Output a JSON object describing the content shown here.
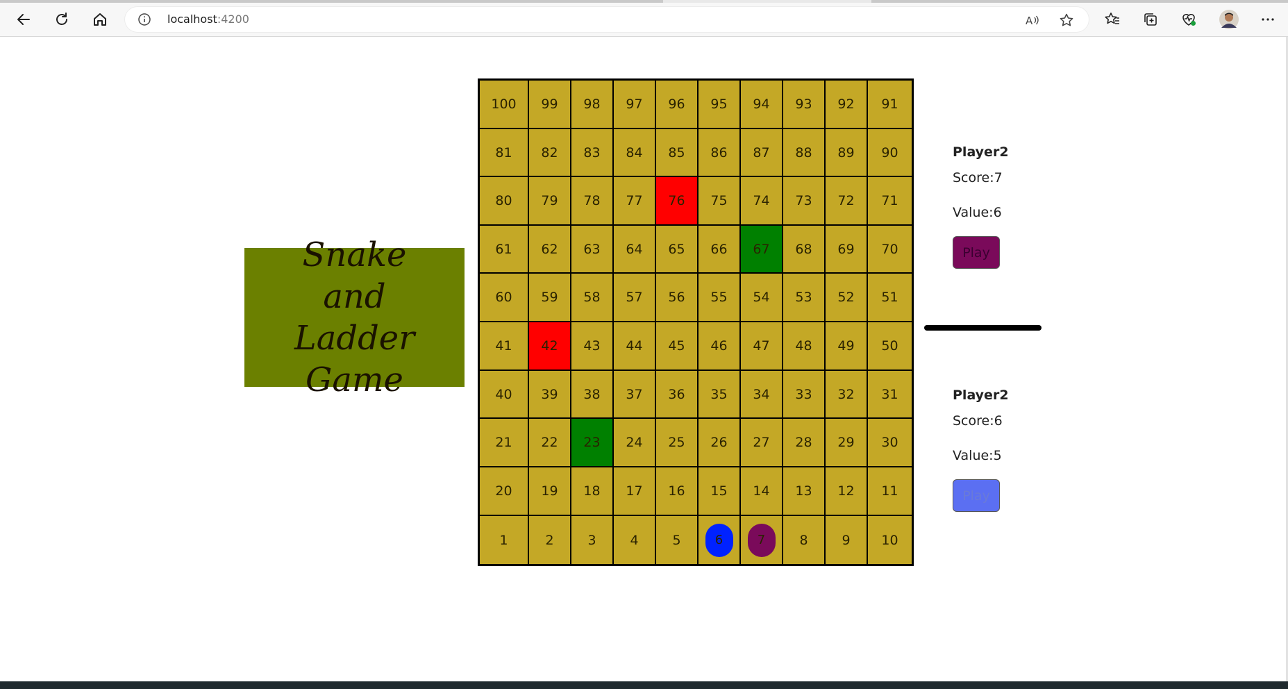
{
  "browser": {
    "url_host": "localhost",
    "url_port": ":4200"
  },
  "title": {
    "line1": "Snake",
    "line2": "and",
    "line3": "Ladder Game",
    "background_color": "#6b8000"
  },
  "board": {
    "rows": [
      [
        100,
        99,
        98,
        97,
        96,
        95,
        94,
        93,
        92,
        91
      ],
      [
        81,
        82,
        83,
        84,
        85,
        86,
        87,
        88,
        89,
        90
      ],
      [
        80,
        79,
        78,
        77,
        76,
        75,
        74,
        73,
        72,
        71
      ],
      [
        61,
        62,
        63,
        64,
        65,
        66,
        67,
        68,
        69,
        70
      ],
      [
        60,
        59,
        58,
        57,
        56,
        55,
        54,
        53,
        52,
        51
      ],
      [
        41,
        42,
        43,
        44,
        45,
        46,
        47,
        48,
        49,
        50
      ],
      [
        40,
        39,
        38,
        37,
        36,
        35,
        34,
        33,
        32,
        31
      ],
      [
        21,
        22,
        23,
        24,
        25,
        26,
        27,
        28,
        29,
        30
      ],
      [
        20,
        19,
        18,
        17,
        16,
        15,
        14,
        13,
        12,
        11
      ],
      [
        1,
        2,
        3,
        4,
        5,
        6,
        7,
        8,
        9,
        10
      ]
    ],
    "snake_cells": [
      76,
      42
    ],
    "ladder_cells": [
      67,
      23
    ],
    "cell_color": "#c4a826",
    "snake_color": "#ff0000",
    "ladder_color": "#008000",
    "tokens": [
      {
        "cell": 6,
        "label": "6",
        "color": "#0022ff"
      },
      {
        "cell": 7,
        "label": "7",
        "color": "#7a0a5a"
      }
    ]
  },
  "players": [
    {
      "name": "Player2",
      "score": "Score:7",
      "value": "Value:6",
      "play_label": "Play",
      "button_color": "#7a0a5a"
    },
    {
      "name": "Player2",
      "score": "Score:6",
      "value": "Value:5",
      "play_label": "Play",
      "button_color": "#5b6ff2"
    }
  ]
}
